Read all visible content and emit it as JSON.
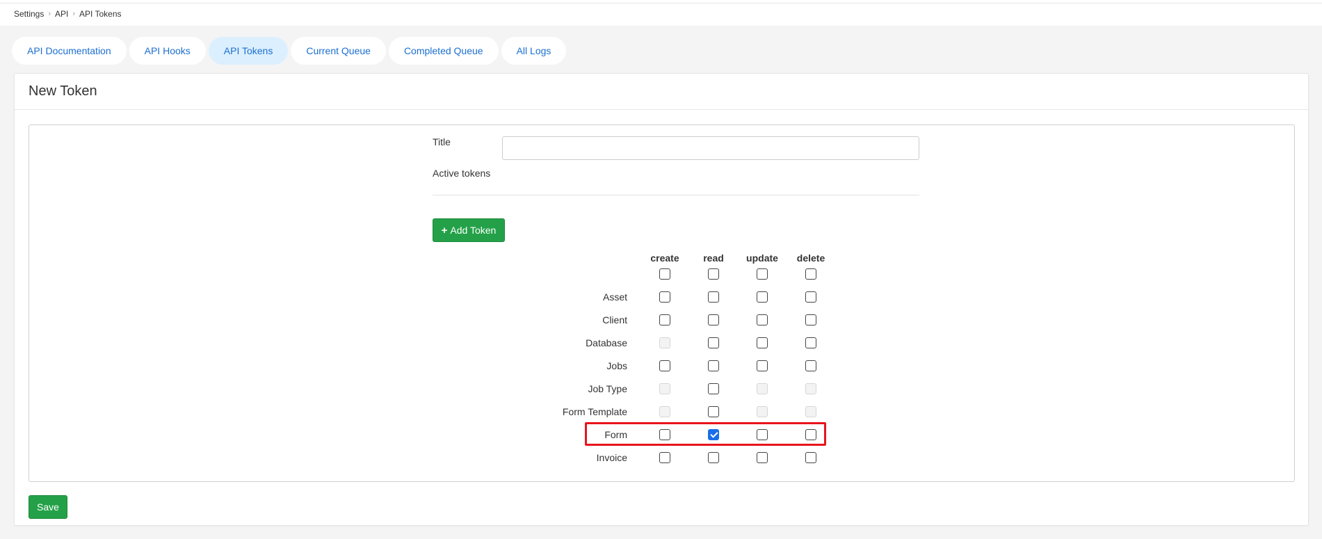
{
  "breadcrumb": {
    "items": [
      "Settings",
      "API",
      "API Tokens"
    ]
  },
  "tabs": [
    {
      "label": "API Documentation",
      "active": false
    },
    {
      "label": "API Hooks",
      "active": false
    },
    {
      "label": "API Tokens",
      "active": true
    },
    {
      "label": "Current Queue",
      "active": false
    },
    {
      "label": "Completed Queue",
      "active": false
    },
    {
      "label": "All Logs",
      "active": false
    }
  ],
  "card": {
    "title": "New Token"
  },
  "form": {
    "title_label": "Title",
    "title_value": "",
    "active_tokens_label": "Active tokens",
    "add_token_label": "Add Token"
  },
  "permissions": {
    "columns": [
      "create",
      "read",
      "update",
      "delete"
    ],
    "select_all": [
      false,
      false,
      false,
      false
    ],
    "rows": [
      {
        "label": "Asset",
        "create": "unchecked",
        "read": "unchecked",
        "update": "unchecked",
        "delete": "unchecked"
      },
      {
        "label": "Client",
        "create": "unchecked",
        "read": "unchecked",
        "update": "unchecked",
        "delete": "unchecked"
      },
      {
        "label": "Database",
        "create": "disabled",
        "read": "unchecked",
        "update": "unchecked",
        "delete": "unchecked"
      },
      {
        "label": "Jobs",
        "create": "unchecked",
        "read": "unchecked",
        "update": "unchecked",
        "delete": "unchecked"
      },
      {
        "label": "Job Type",
        "create": "disabled",
        "read": "unchecked",
        "update": "disabled",
        "delete": "disabled"
      },
      {
        "label": "Form Template",
        "create": "disabled",
        "read": "unchecked",
        "update": "disabled",
        "delete": "disabled"
      },
      {
        "label": "Form",
        "create": "unchecked",
        "read": "checked",
        "update": "unchecked",
        "delete": "unchecked",
        "highlighted": true
      },
      {
        "label": "Invoice",
        "create": "unchecked",
        "read": "unchecked",
        "update": "unchecked",
        "delete": "unchecked"
      }
    ]
  },
  "save_label": "Save",
  "colors": {
    "accent": "#1b6fd0",
    "active_tab_bg": "#dcefff",
    "green": "#24a148",
    "highlight": "#e8141c",
    "checked": "#1a6fe8"
  }
}
